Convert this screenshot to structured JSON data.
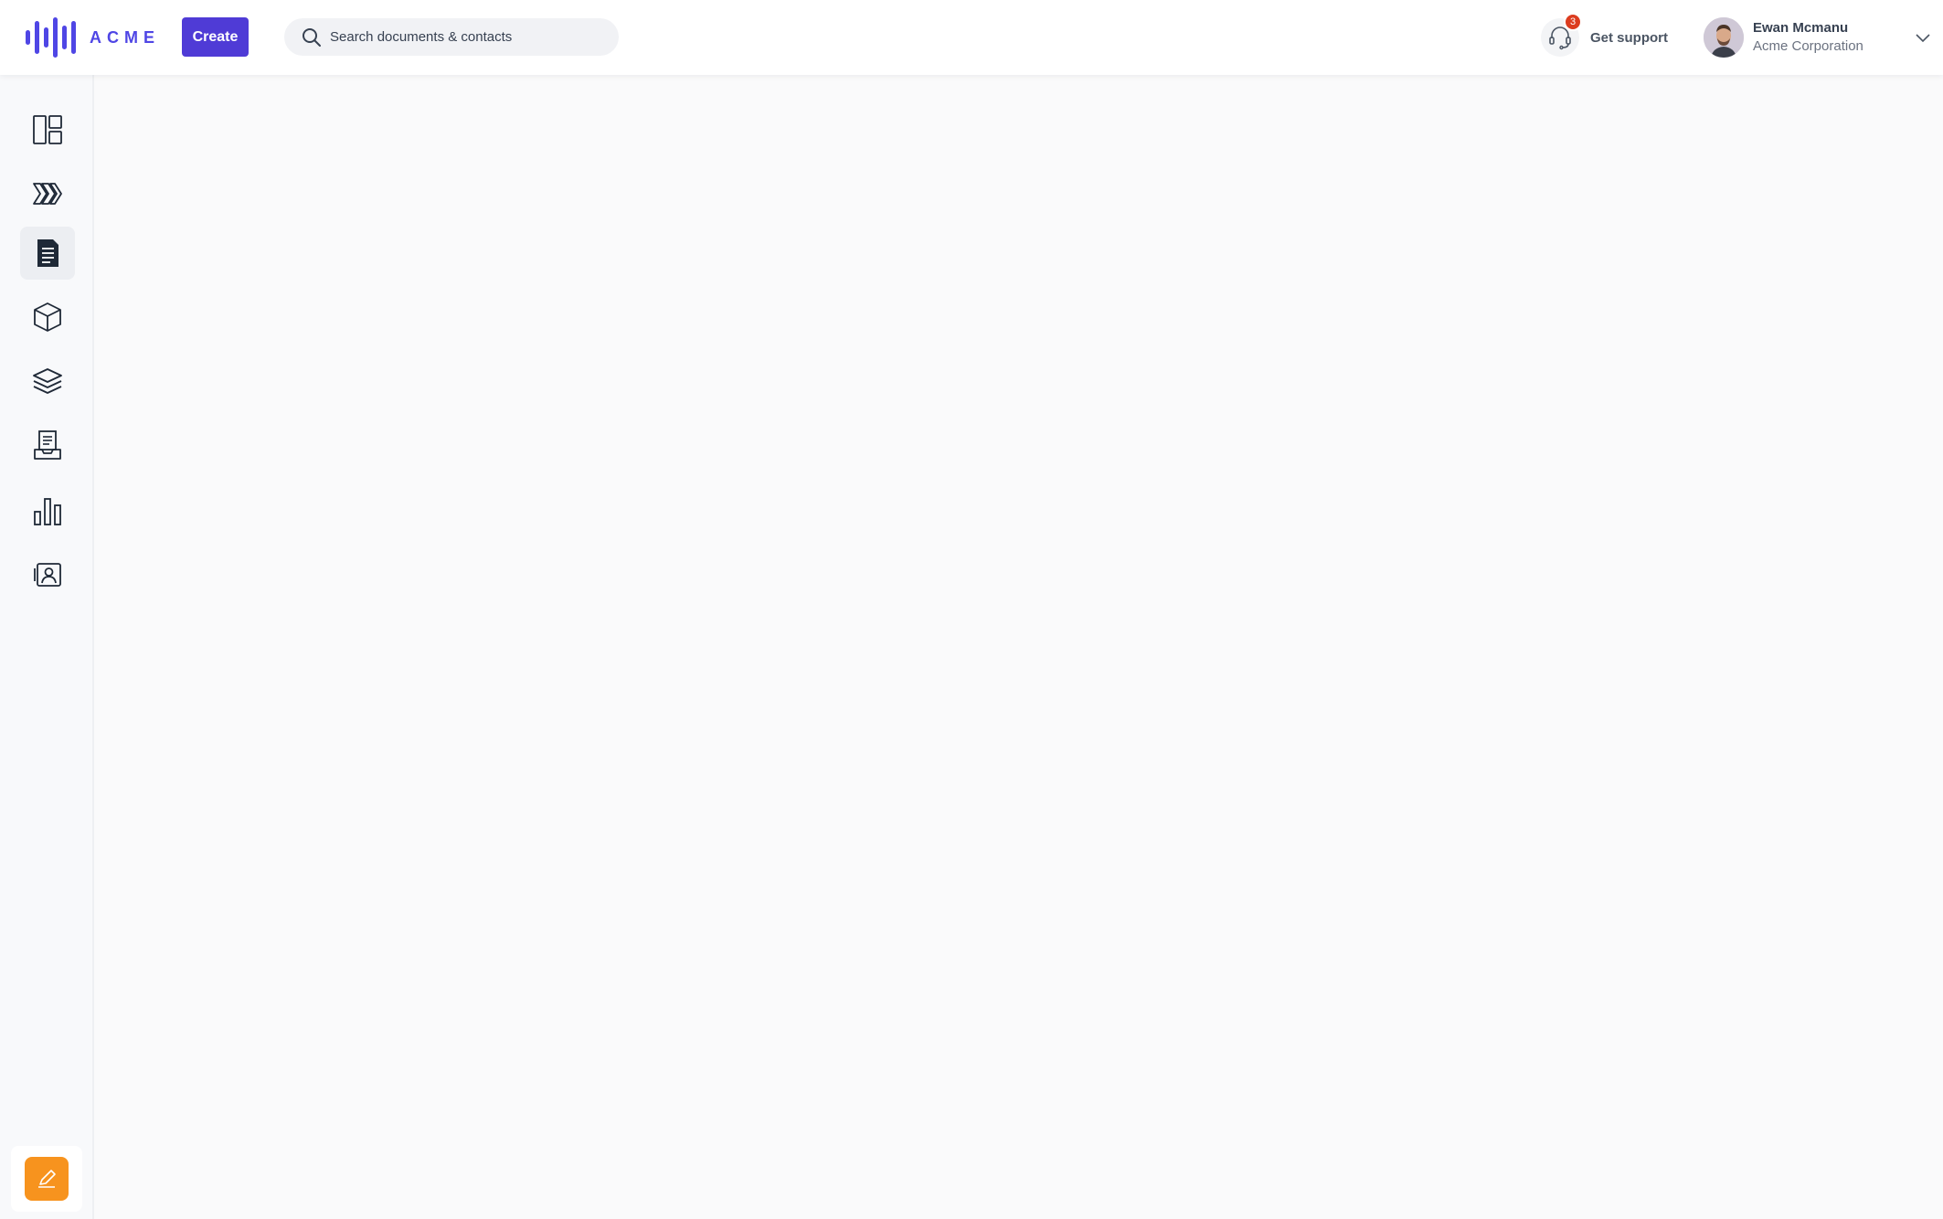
{
  "brand": {
    "name": "ACME",
    "color": "#4f46e5"
  },
  "header": {
    "create_label": "Create",
    "search_placeholder": "Search documents & contacts",
    "support": {
      "label": "Get support",
      "badge_count": "3",
      "icon": "headset-icon"
    },
    "user": {
      "name": "Ewan Mcmanu",
      "organization": "Acme Corporation"
    }
  },
  "sidebar": {
    "items": [
      {
        "icon": "dashboard-icon"
      },
      {
        "icon": "pipeline-icon"
      },
      {
        "icon": "document-icon",
        "active": true
      },
      {
        "icon": "product-box-icon"
      },
      {
        "icon": "layers-icon"
      },
      {
        "icon": "inbox-tray-icon"
      },
      {
        "icon": "bar-chart-icon"
      },
      {
        "icon": "contact-card-icon"
      }
    ],
    "action": {
      "icon": "pencil-icon",
      "color": "#f7931e"
    }
  },
  "colors": {
    "primary": "#4f3bd6",
    "badge": "#dc3c1f",
    "accent": "#f7931e"
  }
}
